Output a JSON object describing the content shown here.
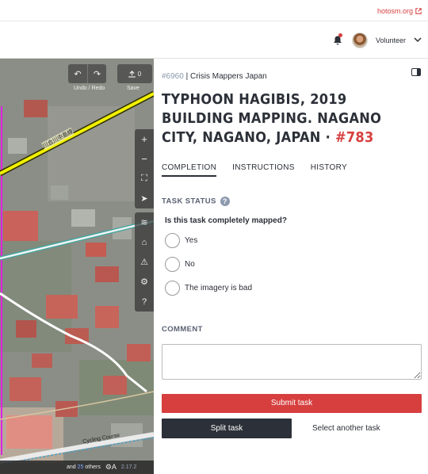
{
  "top": {
    "hot_link": "hotosm.org"
  },
  "nav": {
    "username": "Volunteer"
  },
  "map": {
    "toolbar": {
      "undo_redo_label": "Undo / Redo",
      "save_label": "Save",
      "save_count": "0"
    },
    "road_label": "川合川中島線",
    "cycling_label": "Cycling Course",
    "footer": {
      "others_prefix": "and ",
      "others_count": "25",
      "others_suffix": " others",
      "version": "2.17.2"
    }
  },
  "panel": {
    "project_id": "#6960",
    "organisation": "Crisis Mappers Japan",
    "title": "Typhoon Hagibis, 2019 building mapping. Nagano City, Nagano, Japan",
    "title_separator": " · ",
    "task_number": "#783",
    "tabs": [
      "COMPLETION",
      "INSTRUCTIONS",
      "HISTORY"
    ],
    "task_status_label": "TASK STATUS",
    "help_glyph": "?",
    "question": "Is this task completely mapped?",
    "options": [
      "Yes",
      "No",
      "The imagery is bad"
    ],
    "comment_label": "COMMENT",
    "submit_label": "Submit task",
    "split_label": "Split task",
    "select_another_label": "Select another task"
  },
  "colors": {
    "accent": "#d73f3f",
    "dark": "#2c3038",
    "road_yellow": "#f0f000",
    "boundary_magenta": "#e020e0"
  }
}
